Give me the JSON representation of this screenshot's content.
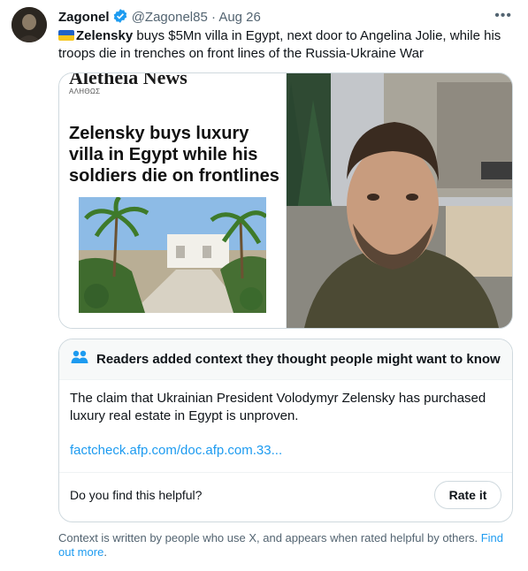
{
  "tweet": {
    "author_name": "Zagonel",
    "handle": "@Zagonel85",
    "separator": "·",
    "date": "Aug 26",
    "more_icon": "more-horizontal-icon",
    "flag_emoji": "ukraine-flag",
    "text_bold": "Zelensky",
    "text_rest": " buys $5Mn villa in Egypt, next door to Angelina Jolie, while his troops die in trenches on front lines of the Russia-Ukraine War"
  },
  "media": {
    "left": {
      "masthead": "Aletheia News",
      "subhead": "ΑΛΗΘΩΣ",
      "headline": "Zelensky buys luxury villa in Egypt while his soldiers die on frontlines"
    }
  },
  "community_note": {
    "icon": "people-icon",
    "title": "Readers added context they thought people might want to know",
    "body": "The claim that Ukrainian President Volodymyr Zelensky has purchased luxury real estate in Egypt is unproven.",
    "link": "factcheck.afp.com/doc.afp.com.33...",
    "question": "Do you find this helpful?",
    "rate_label": "Rate it"
  },
  "footer": {
    "text": "Context is written by people who use X, and appears when rated helpful by others. ",
    "link": "Find out more",
    "period": "."
  },
  "colors": {
    "accent": "#1d9bf0",
    "text": "#0f1419",
    "muted": "#536471",
    "border": "#cfd9de"
  }
}
